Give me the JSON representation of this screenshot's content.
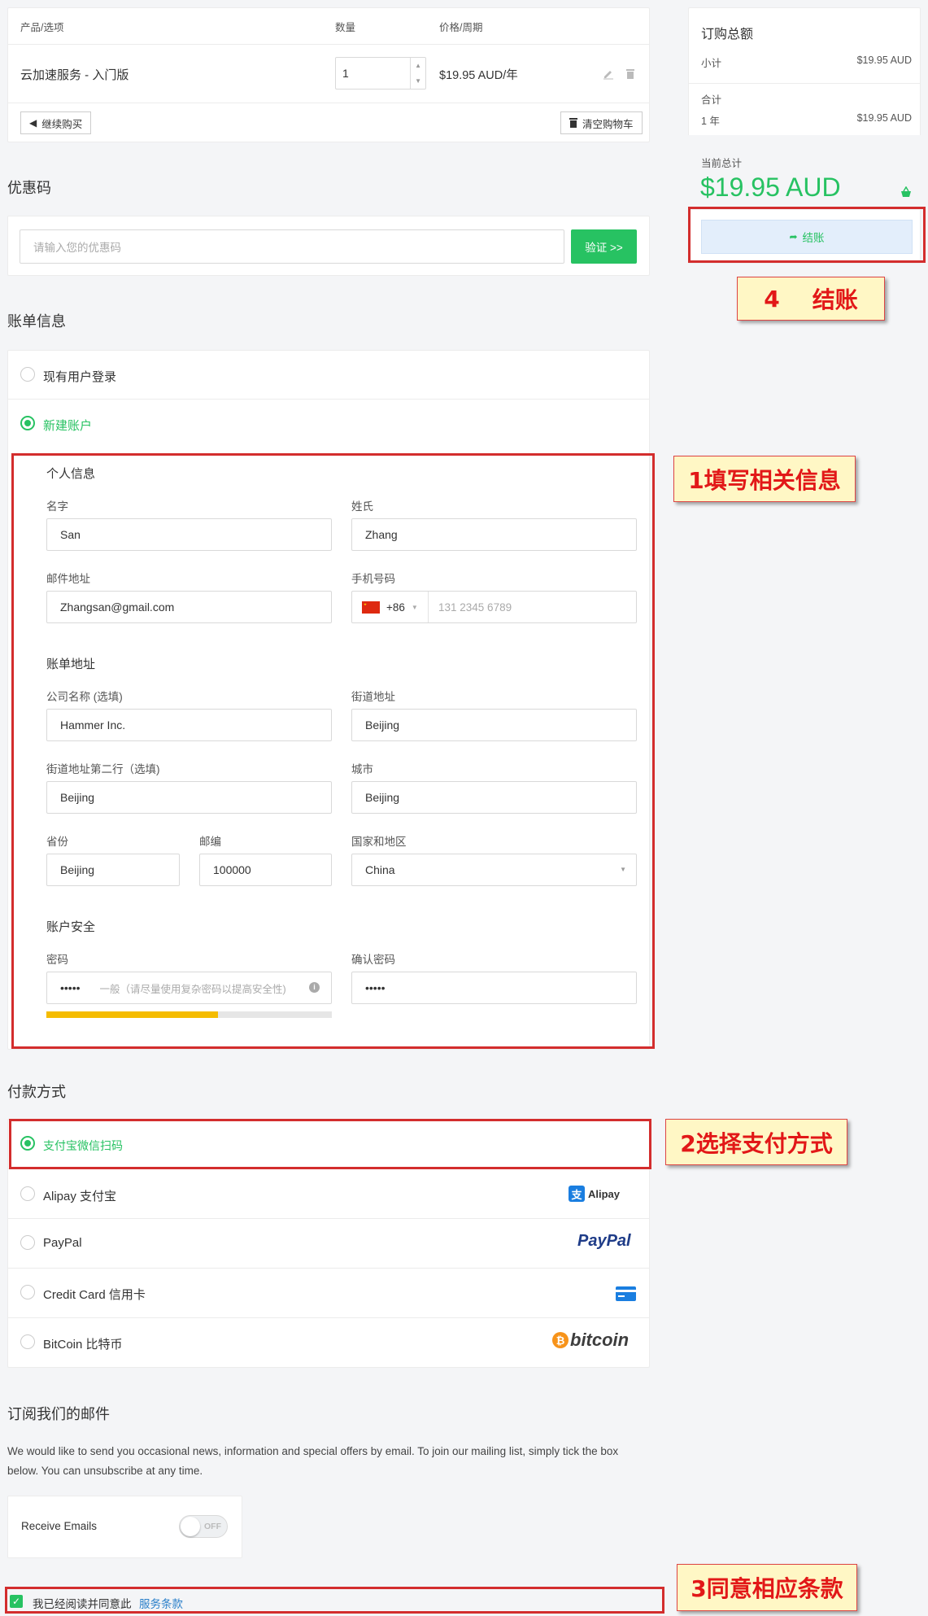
{
  "cart": {
    "col_product": "产品/选项",
    "col_qty": "数量",
    "col_price": "价格/周期",
    "product_name": "云加速服务 - 入门版",
    "quantity": "1",
    "price": "$19.95 AUD/年",
    "continue_shopping": "继续购买",
    "empty_cart": "清空购物车"
  },
  "promo": {
    "title": "优惠码",
    "placeholder": "请输入您的优惠码",
    "validate_button": "验证 >>"
  },
  "summary": {
    "title": "订购总额",
    "subtotal_label": "小计",
    "subtotal_value": "$19.95 AUD",
    "total_label": "合计",
    "period_label": "1 年",
    "period_value": "$19.95 AUD",
    "current_total_label": "当前总计",
    "current_total_value": "$19.95 AUD",
    "checkout_button": "结账"
  },
  "billing": {
    "title": "账单信息",
    "existing_user": "现有用户登录",
    "new_account": "新建账户",
    "personal_info": "个人信息",
    "first_name_label": "名字",
    "first_name": "San",
    "last_name_label": "姓氏",
    "last_name": "Zhang",
    "email_label": "邮件地址",
    "email": "Zhangsan@gmail.com",
    "phone_label": "手机号码",
    "phone_code": "+86",
    "phone_placeholder": "131 2345 6789",
    "address_title": "账单地址",
    "company_label": "公司名称 (选填)",
    "company": "Hammer Inc.",
    "street_label": "街道地址",
    "street": "Beijing",
    "street2_label": "街道地址第二行（选填)",
    "street2": "Beijing",
    "city_label": "城市",
    "city": "Beijing",
    "province_label": "省份",
    "province": "Beijing",
    "postcode_label": "邮编",
    "postcode": "100000",
    "country_label": "国家和地区",
    "country": "China",
    "security_title": "账户安全",
    "password_label": "密码",
    "password": "•••••",
    "password_hint": "一般（请尽量使用复杂密码以提高安全性)",
    "password_strength": 0.6,
    "confirm_label": "确认密码",
    "confirm_password": "•••••"
  },
  "payment": {
    "title": "付款方式",
    "methods": [
      {
        "label": "支付宝微信扫码",
        "selected": true
      },
      {
        "label": "Alipay 支付宝",
        "brand": "Alipay"
      },
      {
        "label": "PayPal",
        "brand": "PayPal"
      },
      {
        "label": "Credit Card 信用卡"
      },
      {
        "label": "BitCoin 比特币",
        "brand": "bitcoin"
      }
    ]
  },
  "mailing": {
    "title": "订阅我们的邮件",
    "description_line1": "We would like to send you occasional news, information and special offers by email. To join our mailing list, simply tick the box",
    "description_line2": "below. You can unsubscribe at any time.",
    "receive_label": "Receive Emails",
    "toggle_state": "OFF"
  },
  "terms": {
    "text": "我已经阅读并同意此",
    "link": "服务条款"
  },
  "annotations": {
    "step1": "1填写相关信息",
    "step2": "2选择支付方式",
    "step3": "3同意相应条款",
    "step4_num": "4",
    "step4_text": "结账"
  },
  "colors": {
    "accent": "#27c262",
    "annotation_red": "#d32d2d",
    "link": "#2a7fc9"
  }
}
